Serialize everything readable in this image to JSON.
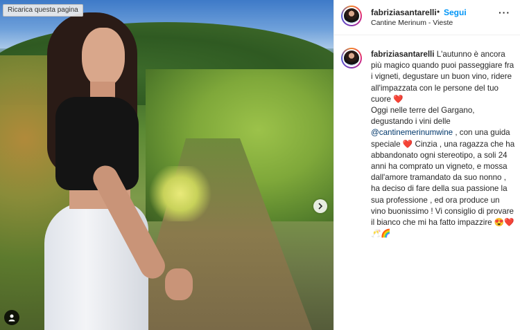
{
  "photo": {
    "reload_label": "Ricarica questa pagina"
  },
  "header": {
    "username": "fabriziasantarelli",
    "separator": "•",
    "follow_label": "Segui",
    "location": "Cantine Merinum - Vieste",
    "more_label": "···"
  },
  "caption": {
    "username": "fabriziasantarelli",
    "line1": "L'autunno è ancora più magico quando puoi passeggiare fra i vigneti, degustare un buon vino, ridere all'impazzata con le persone del tuo cuore",
    "heart": "❤️",
    "line2": "Oggi nelle terre del Gargano, degustando i vini delle",
    "mention": "@cantinemerinumwine",
    "line3a": ", con una guida speciale",
    "line3b": "Cinzia , una ragazza che ha abbandonato ogni stereotipo, a soli 24 anni ha comprato un vigneto, e mossa dall'amore tramandato da suo nonno , ha deciso di fare della sua passione la sua professione , ed ora produce un vino buonissimo ! Vi consiglio di provare il bianco che mi ha fatto impazzire",
    "emojis_end": "😍❤️🥂🌈"
  },
  "colors": {
    "follow": "#0095f6",
    "mention": "#00376b",
    "text": "#262626"
  },
  "icons": [
    "chevron-right-icon",
    "user-tag-icon",
    "more-options-icon"
  ]
}
